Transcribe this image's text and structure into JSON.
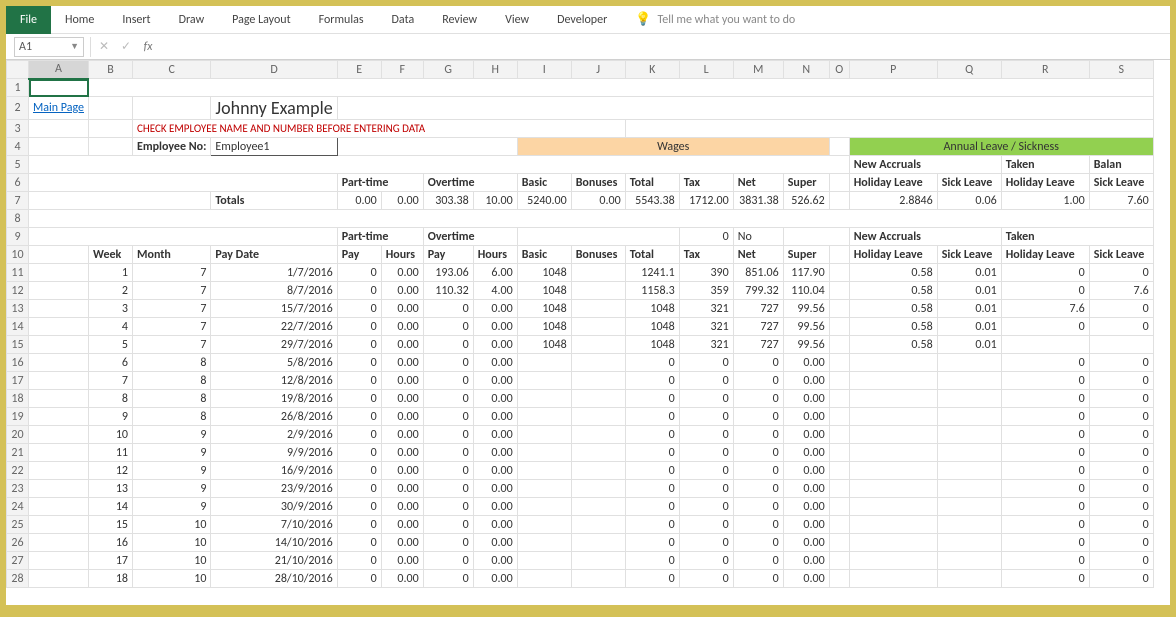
{
  "ribbon": {
    "file": "File",
    "tabs": [
      "Home",
      "Insert",
      "Draw",
      "Page Layout",
      "Formulas",
      "Data",
      "Review",
      "View",
      "Developer"
    ],
    "tellme": "Tell me what you want to do"
  },
  "fbar": {
    "namebox": "A1",
    "formula": ""
  },
  "cols": [
    "A",
    "B",
    "C",
    "D",
    "E",
    "F",
    "G",
    "H",
    "I",
    "J",
    "K",
    "L",
    "M",
    "N",
    "O",
    "P",
    "Q",
    "R",
    "S"
  ],
  "row2": {
    "mainpage": "Main Page",
    "title": "Johnny Example"
  },
  "row3": {
    "warn": "CHECK EMPLOYEE NAME AND NUMBER BEFORE ENTERING DATA"
  },
  "row4": {
    "emp_label": "Employee No:",
    "emp_value": "Employee1",
    "wages": "Wages",
    "leave": "Annual Leave / Sickness"
  },
  "row5": {
    "new_accruals": "New Accruals",
    "taken": "Taken",
    "balan": "Balan"
  },
  "row6": {
    "parttime": "Part-time",
    "overtime": "Overtime",
    "basic": "Basic",
    "bonuses": "Bonuses",
    "total": "Total",
    "tax": "Tax",
    "net": "Net",
    "super": "Super",
    "hl": "Holiday Leave",
    "sl": "Sick Leave"
  },
  "row7": {
    "totals": "Totals",
    "e": "0.00",
    "f": "0.00",
    "g": "303.38",
    "h": "10.00",
    "i": "5240.00",
    "j": "0.00",
    "k": "5543.38",
    "l": "1712.00",
    "m": "3831.38",
    "n": "526.62",
    "p": "2.8846",
    "q": "0.06",
    "r": "1.00",
    "s": "7.60"
  },
  "row9": {
    "parttime": "Part-time",
    "overtime": "Overtime",
    "l": "0",
    "m": "No",
    "new_accruals": "New Accruals",
    "taken": "Taken"
  },
  "row10": {
    "week": "Week",
    "month": "Month",
    "paydate": "Pay Date",
    "pay": "Pay",
    "hours": "Hours",
    "basic": "Basic",
    "bonuses": "Bonuses",
    "total": "Total",
    "tax": "Tax",
    "net": "Net",
    "super": "Super",
    "hl": "Holiday Leave",
    "sl": "Sick Leave"
  },
  "rows": [
    {
      "rn": "11",
      "wk": "1",
      "mo": "7",
      "pd": "1/7/2016",
      "e": "0",
      "f": "0.00",
      "g": "193.06",
      "h": "6.00",
      "i": "1048",
      "j": "",
      "k": "1241.1",
      "l": "390",
      "m": "851.06",
      "n": "117.90",
      "p": "0.58",
      "q": "0.01",
      "r": "0",
      "s": "0"
    },
    {
      "rn": "12",
      "wk": "2",
      "mo": "7",
      "pd": "8/7/2016",
      "e": "0",
      "f": "0.00",
      "g": "110.32",
      "h": "4.00",
      "i": "1048",
      "j": "",
      "k": "1158.3",
      "l": "359",
      "m": "799.32",
      "n": "110.04",
      "p": "0.58",
      "q": "0.01",
      "r": "0",
      "s": "7.6"
    },
    {
      "rn": "13",
      "wk": "3",
      "mo": "7",
      "pd": "15/7/2016",
      "e": "0",
      "f": "0.00",
      "g": "0",
      "h": "0.00",
      "i": "1048",
      "j": "",
      "k": "1048",
      "l": "321",
      "m": "727",
      "n": "99.56",
      "p": "0.58",
      "q": "0.01",
      "r": "7.6",
      "s": "0"
    },
    {
      "rn": "14",
      "wk": "4",
      "mo": "7",
      "pd": "22/7/2016",
      "e": "0",
      "f": "0.00",
      "g": "0",
      "h": "0.00",
      "i": "1048",
      "j": "",
      "k": "1048",
      "l": "321",
      "m": "727",
      "n": "99.56",
      "p": "0.58",
      "q": "0.01",
      "r": "0",
      "s": "0"
    },
    {
      "rn": "15",
      "wk": "5",
      "mo": "7",
      "pd": "29/7/2016",
      "e": "0",
      "f": "0.00",
      "g": "0",
      "h": "0.00",
      "i": "1048",
      "j": "",
      "k": "1048",
      "l": "321",
      "m": "727",
      "n": "99.56",
      "p": "0.58",
      "q": "0.01",
      "r": "",
      "s": ""
    },
    {
      "rn": "16",
      "wk": "6",
      "mo": "8",
      "pd": "5/8/2016",
      "e": "0",
      "f": "0.00",
      "g": "0",
      "h": "0.00",
      "i": "",
      "j": "",
      "k": "0",
      "l": "0",
      "m": "0",
      "n": "0.00",
      "p": "",
      "q": "",
      "r": "0",
      "s": "0"
    },
    {
      "rn": "17",
      "wk": "7",
      "mo": "8",
      "pd": "12/8/2016",
      "e": "0",
      "f": "0.00",
      "g": "0",
      "h": "0.00",
      "i": "",
      "j": "",
      "k": "0",
      "l": "0",
      "m": "0",
      "n": "0.00",
      "p": "",
      "q": "",
      "r": "0",
      "s": "0"
    },
    {
      "rn": "18",
      "wk": "8",
      "mo": "8",
      "pd": "19/8/2016",
      "e": "0",
      "f": "0.00",
      "g": "0",
      "h": "0.00",
      "i": "",
      "j": "",
      "k": "0",
      "l": "0",
      "m": "0",
      "n": "0.00",
      "p": "",
      "q": "",
      "r": "0",
      "s": "0"
    },
    {
      "rn": "19",
      "wk": "9",
      "mo": "8",
      "pd": "26/8/2016",
      "e": "0",
      "f": "0.00",
      "g": "0",
      "h": "0.00",
      "i": "",
      "j": "",
      "k": "0",
      "l": "0",
      "m": "0",
      "n": "0.00",
      "p": "",
      "q": "",
      "r": "0",
      "s": "0"
    },
    {
      "rn": "20",
      "wk": "10",
      "mo": "9",
      "pd": "2/9/2016",
      "e": "0",
      "f": "0.00",
      "g": "0",
      "h": "0.00",
      "i": "",
      "j": "",
      "k": "0",
      "l": "0",
      "m": "0",
      "n": "0.00",
      "p": "",
      "q": "",
      "r": "0",
      "s": "0"
    },
    {
      "rn": "21",
      "wk": "11",
      "mo": "9",
      "pd": "9/9/2016",
      "e": "0",
      "f": "0.00",
      "g": "0",
      "h": "0.00",
      "i": "",
      "j": "",
      "k": "0",
      "l": "0",
      "m": "0",
      "n": "0.00",
      "p": "",
      "q": "",
      "r": "0",
      "s": "0"
    },
    {
      "rn": "22",
      "wk": "12",
      "mo": "9",
      "pd": "16/9/2016",
      "e": "0",
      "f": "0.00",
      "g": "0",
      "h": "0.00",
      "i": "",
      "j": "",
      "k": "0",
      "l": "0",
      "m": "0",
      "n": "0.00",
      "p": "",
      "q": "",
      "r": "0",
      "s": "0"
    },
    {
      "rn": "23",
      "wk": "13",
      "mo": "9",
      "pd": "23/9/2016",
      "e": "0",
      "f": "0.00",
      "g": "0",
      "h": "0.00",
      "i": "",
      "j": "",
      "k": "0",
      "l": "0",
      "m": "0",
      "n": "0.00",
      "p": "",
      "q": "",
      "r": "0",
      "s": "0"
    },
    {
      "rn": "24",
      "wk": "14",
      "mo": "9",
      "pd": "30/9/2016",
      "e": "0",
      "f": "0.00",
      "g": "0",
      "h": "0.00",
      "i": "",
      "j": "",
      "k": "0",
      "l": "0",
      "m": "0",
      "n": "0.00",
      "p": "",
      "q": "",
      "r": "0",
      "s": "0"
    },
    {
      "rn": "25",
      "wk": "15",
      "mo": "10",
      "pd": "7/10/2016",
      "e": "0",
      "f": "0.00",
      "g": "0",
      "h": "0.00",
      "i": "",
      "j": "",
      "k": "0",
      "l": "0",
      "m": "0",
      "n": "0.00",
      "p": "",
      "q": "",
      "r": "0",
      "s": "0"
    },
    {
      "rn": "26",
      "wk": "16",
      "mo": "10",
      "pd": "14/10/2016",
      "e": "0",
      "f": "0.00",
      "g": "0",
      "h": "0.00",
      "i": "",
      "j": "",
      "k": "0",
      "l": "0",
      "m": "0",
      "n": "0.00",
      "p": "",
      "q": "",
      "r": "0",
      "s": "0"
    },
    {
      "rn": "27",
      "wk": "17",
      "mo": "10",
      "pd": "21/10/2016",
      "e": "0",
      "f": "0.00",
      "g": "0",
      "h": "0.00",
      "i": "",
      "j": "",
      "k": "0",
      "l": "0",
      "m": "0",
      "n": "0.00",
      "p": "",
      "q": "",
      "r": "0",
      "s": "0"
    },
    {
      "rn": "28",
      "wk": "18",
      "mo": "10",
      "pd": "28/10/2016",
      "e": "0",
      "f": "0.00",
      "g": "0",
      "h": "0.00",
      "i": "",
      "j": "",
      "k": "0",
      "l": "0",
      "m": "0",
      "n": "0.00",
      "p": "",
      "q": "",
      "r": "0",
      "s": "0"
    }
  ]
}
